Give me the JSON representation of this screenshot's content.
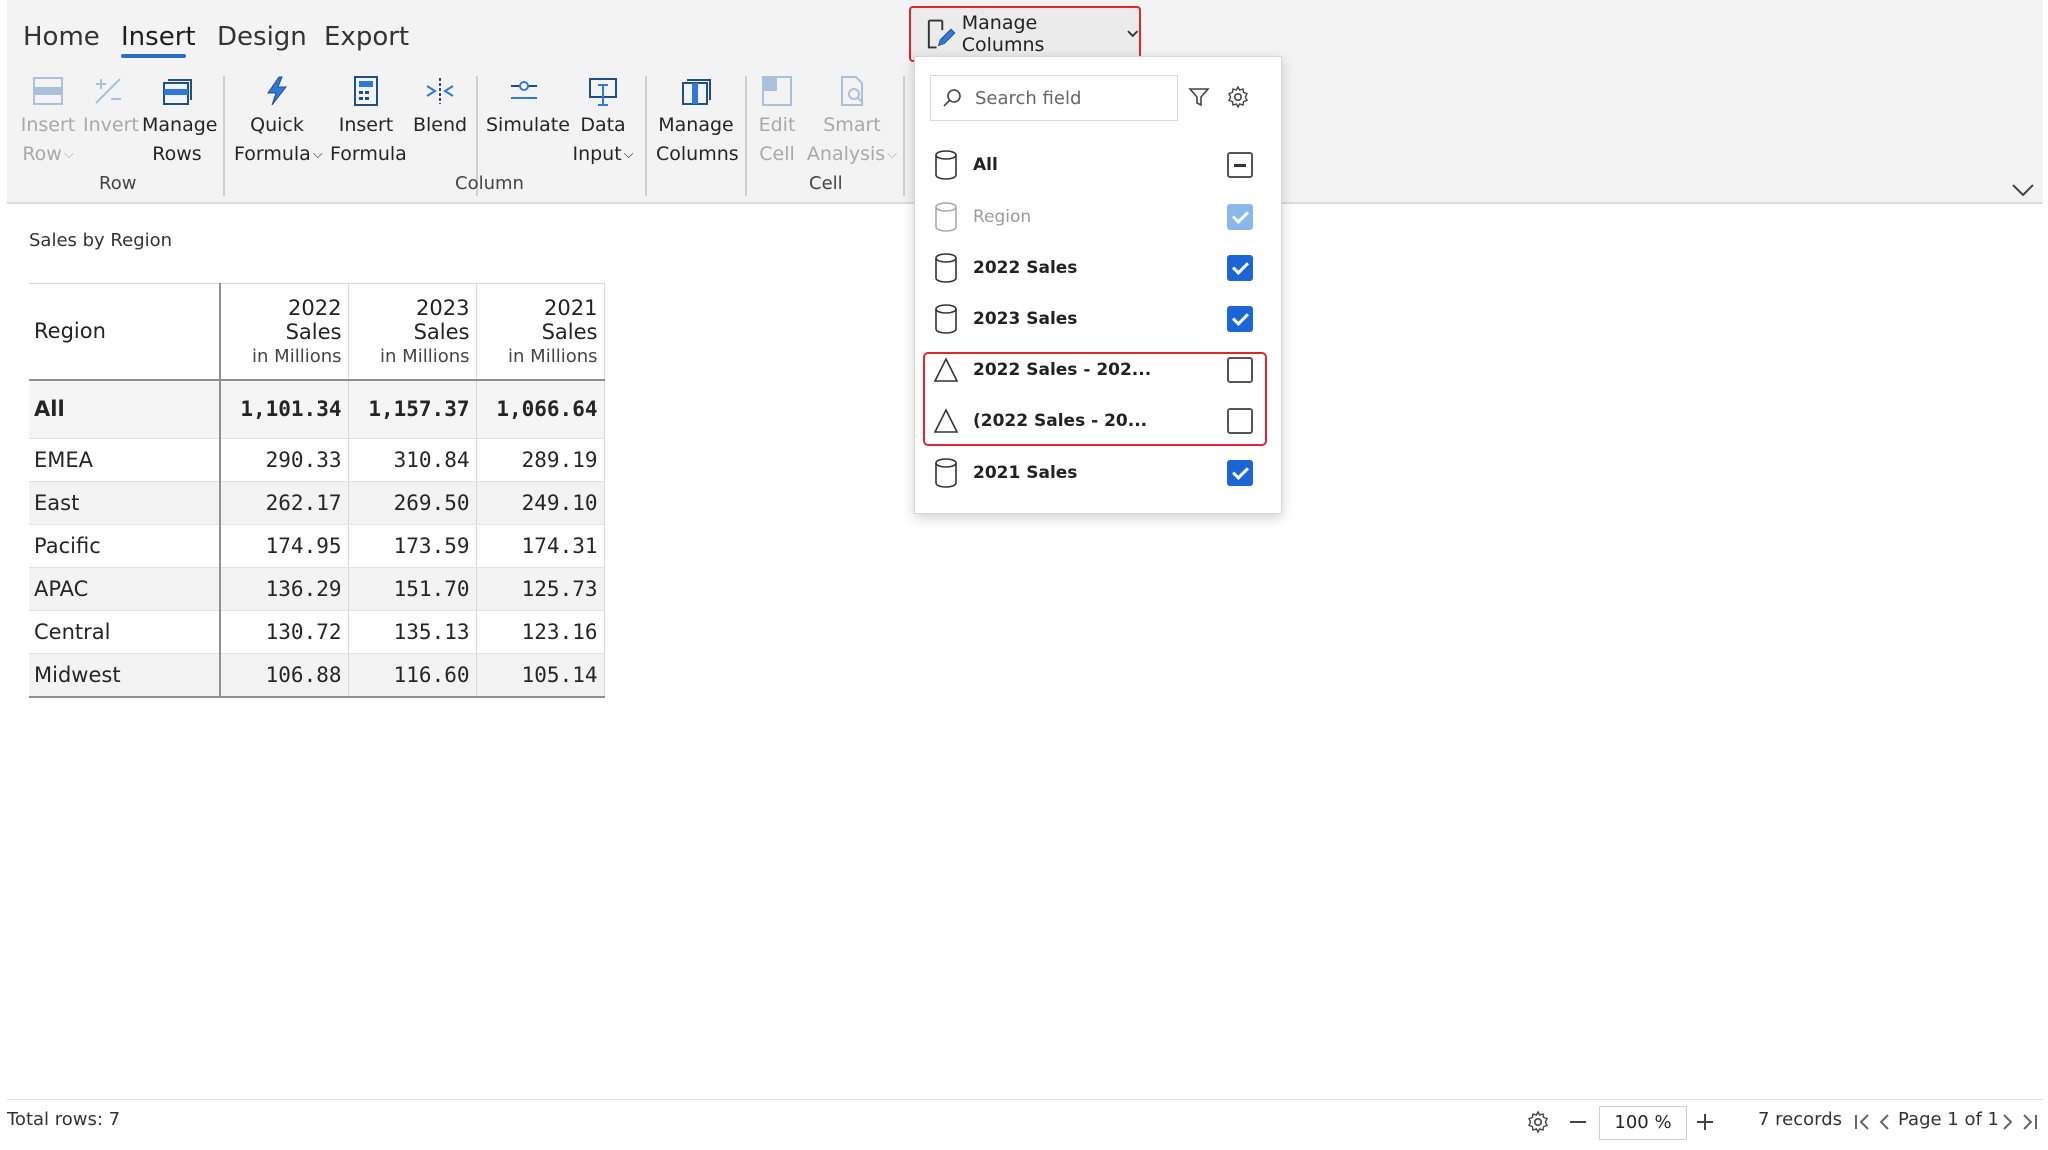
{
  "tabs": [
    {
      "label": "Home"
    },
    {
      "label": "Insert",
      "active": true
    },
    {
      "label": "Design"
    },
    {
      "label": "Export"
    }
  ],
  "ribbon": {
    "insert_row": {
      "line1": "Insert",
      "line2": "Row"
    },
    "invert": {
      "line1": "Invert"
    },
    "manage_rows": {
      "line1": "Manage",
      "line2": "Rows"
    },
    "quick_formula": {
      "line1": "Quick",
      "line2": "Formula"
    },
    "insert_formula": {
      "line1": "Insert",
      "line2": "Formula"
    },
    "blend": {
      "line1": "Blend"
    },
    "simulate": {
      "line1": "Simulate"
    },
    "data_input": {
      "line1": "Data",
      "line2": "Input"
    },
    "manage_columns": {
      "line1": "Manage",
      "line2": "Columns"
    },
    "edit_cell": {
      "line1": "Edit",
      "line2": "Cell"
    },
    "smart_analysis": {
      "line1": "Smart",
      "line2": "Analysis"
    },
    "groups": {
      "row": "Row",
      "column": "Column",
      "cell": "Cell"
    },
    "manage_columns_dropdown_label": "Manage Columns"
  },
  "report": {
    "title": "Sales by Region",
    "columns": {
      "region": "Region",
      "c1": {
        "main": "2022 Sales",
        "sub": "in Millions"
      },
      "c2": {
        "main": "2023 Sales",
        "sub": "in Millions"
      },
      "c3": {
        "main": "2021 Sales",
        "sub": "in Millions"
      }
    },
    "rows": [
      {
        "region": "All",
        "v1": "1,101.34",
        "v2": "1,157.37",
        "v3": "1,066.64"
      },
      {
        "region": "EMEA",
        "v1": "290.33",
        "v2": "310.84",
        "v3": "289.19"
      },
      {
        "region": "East",
        "v1": "262.17",
        "v2": "269.50",
        "v3": "249.10"
      },
      {
        "region": "Pacific",
        "v1": "174.95",
        "v2": "173.59",
        "v3": "174.31"
      },
      {
        "region": "APAC",
        "v1": "136.29",
        "v2": "151.70",
        "v3": "125.73"
      },
      {
        "region": "Central",
        "v1": "130.72",
        "v2": "135.13",
        "v3": "123.16"
      },
      {
        "region": "Midwest",
        "v1": "106.88",
        "v2": "116.60",
        "v3": "105.14"
      }
    ]
  },
  "dropdown": {
    "search_placeholder": "Search field",
    "fields": [
      {
        "label": "All",
        "icon": "cylinder-icon",
        "state": "partial"
      },
      {
        "label": "Region",
        "icon": "cylinder-icon",
        "state": "checked-disabled"
      },
      {
        "label": "2022 Sales",
        "icon": "cylinder-icon",
        "state": "checked"
      },
      {
        "label": "2023 Sales",
        "icon": "cylinder-icon",
        "state": "checked"
      },
      {
        "label": "2022 Sales - 202...",
        "icon": "delta-icon",
        "state": "unchecked"
      },
      {
        "label": "(2022 Sales - 20...",
        "icon": "delta-icon",
        "state": "unchecked"
      },
      {
        "label": "2021 Sales",
        "icon": "cylinder-icon",
        "state": "checked"
      }
    ]
  },
  "footer": {
    "total_rows": "Total rows: 7",
    "zoom": "100 %",
    "records": "7 records",
    "page": "Page 1 of 1"
  },
  "colors": {
    "accent": "#1a66d6",
    "highlight": "#e0262c",
    "tab_underline": "#2b6dc7"
  }
}
